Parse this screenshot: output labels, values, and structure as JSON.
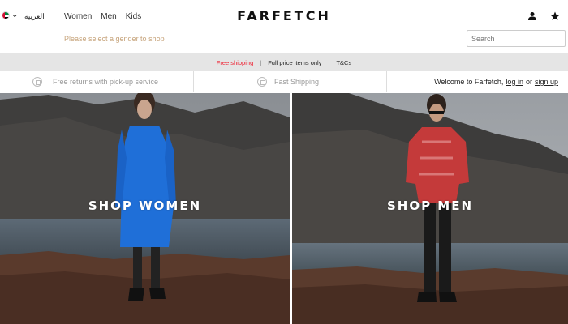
{
  "header": {
    "language_label": "العربية",
    "logo": "FARFETCH",
    "nav": [
      "Women",
      "Men",
      "Kids"
    ],
    "gender_hint": "Please select a gender to shop",
    "search_placeholder": "Search",
    "icons": [
      "account-icon",
      "wishlist-star-icon"
    ],
    "flag": "uae-flag-icon"
  },
  "promo_bar": {
    "free_shipping": "Free shipping",
    "separator": "|",
    "condition": "Full price items only",
    "terms_link": "T&Cs",
    "accent_color": "#e62e2e"
  },
  "usp_bar": {
    "returns": "Free returns with pick-up service",
    "shipping": "Fast Shipping",
    "welcome_prefix": "Welcome to Farfetch,",
    "login_link": "log in",
    "or_text": "or",
    "signup_link": "sign up"
  },
  "heroes": {
    "women_cta": "SHOP WOMEN",
    "men_cta": "SHOP MEN"
  }
}
